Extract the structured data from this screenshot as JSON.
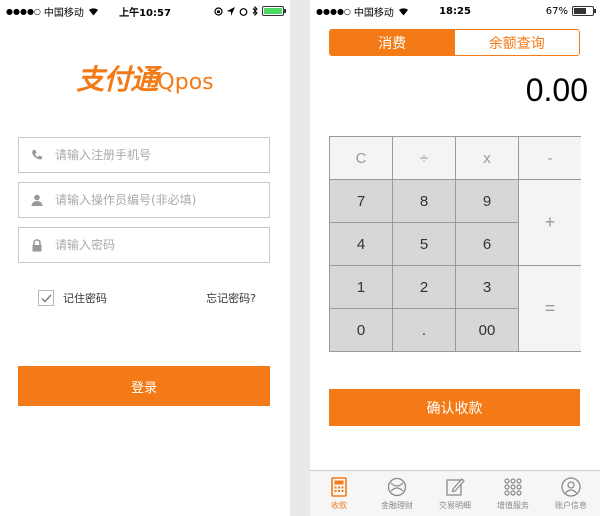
{
  "left_status": {
    "carrier": "中国移动",
    "time": "上午10:57"
  },
  "right_status": {
    "carrier": "中国移动",
    "time": "18:25",
    "battery": "67%"
  },
  "login": {
    "logo_cn": "支付通",
    "logo_en": "Qpos",
    "phone_placeholder": "请输入注册手机号",
    "operator_placeholder": "请输入操作员编号(非必填)",
    "password_placeholder": "请输入密码",
    "remember_label": "记住密码",
    "forgot_label": "忘记密码?",
    "login_button": "登录"
  },
  "calc": {
    "tab_consume": "消费",
    "tab_balance": "余额查询",
    "amount": "0.00",
    "keys": {
      "clear": "C",
      "divide": "÷",
      "multiply": "x",
      "minus": "-",
      "k7": "7",
      "k8": "8",
      "k9": "9",
      "plus": "+",
      "k4": "4",
      "k5": "5",
      "k6": "6",
      "k1": "1",
      "k2": "2",
      "k3": "3",
      "equals": "=",
      "k0": "0",
      "dot": ".",
      "k00": "00"
    },
    "confirm_button": "确认收款"
  },
  "tabbar": [
    {
      "label": "收款",
      "icon": "cashier-icon",
      "active": true
    },
    {
      "label": "金融理财",
      "icon": "finance-icon"
    },
    {
      "label": "交易明细",
      "icon": "edit-list-icon"
    },
    {
      "label": "增值服务",
      "icon": "grid-dots-icon"
    },
    {
      "label": "账户信息",
      "icon": "user-icon"
    }
  ],
  "colors": {
    "accent": "#f47a17"
  }
}
